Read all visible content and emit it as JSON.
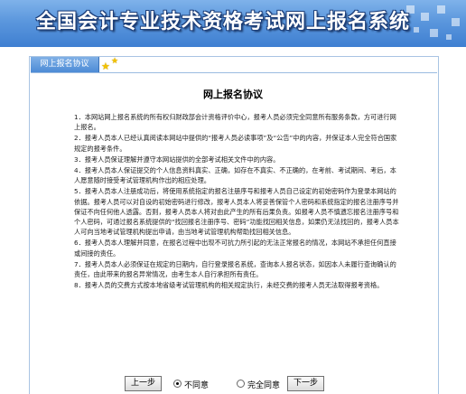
{
  "header": {
    "title": "全国会计专业技术资格考试网上报名系统"
  },
  "tab": {
    "label": "网上报名协议"
  },
  "agreement": {
    "title": "网上报名协议",
    "clauses": [
      "1．本网站网上报名系统的所有权归财政部会计资格评价中心，报考人员必须完全同意所有服务条款，方可进行网上报名。",
      "2．报考人员本人已经认真阅读本网站中提供的“报考人员必读事项”及“公告”中的内容，并保证本人完全符合国家规定的报考条件。",
      "3．报考人员保证理解并遵守本网站提供的全部考试相关文件中的内容。",
      "4．报考人员本人保证提交的个人信息资料真实、正确，如存在不真实、不正确的，在考前、考试期间、考后，本人愿意随时接受考试管理机构作出的相应处理。",
      "5．报考人员本人注册成功后，将使用系统指定的报名注册序号和报考人员自己设定的初始密码作为登录本网站的依据。报考人员可以对自设的初始密码进行修改，报考人员本人将妥善保管个人密码和系统指定的报名注册序号并保证不向任何他人透露。否则，报考人员本人将对由此产生的所有后果负责。如报考人员不慎遗忘报名注册序号和个人密码，可通过报名系统提供的“找回报名注册序号、密码”功能找回相关信息，如果仍无法找回的，报考人员本人可向当地考试管理机构提出申请，由当地考试管理机构帮助找回相关信息。",
      "6．报考人员本人理解并同意，在报名过程中出现不可抗力所引起的无法正常报名的情况，本网站不承担任何直接或间接的责任。",
      "7．报考人员本人必须保证在规定的日期内，自行登录报名系统，查询本人报名状态，如因本人未履行查询确认的责任，由此带来的报名异常情况，由考生本人自行承担所有责任。",
      "8．报考人员的交费方式按本地省级考试管理机构的相关规定执行，未经交费的报考人员无法取得报考资格。"
    ]
  },
  "controls": {
    "prev_label": "上一步",
    "disagree_label": "不同意",
    "agree_label": "完全同意",
    "next_label": "下一步",
    "selected": "disagree"
  },
  "colors": {
    "banner": "#4d8bd6",
    "tab": "#5b97dd",
    "frame_border": "#a9c4e3"
  }
}
